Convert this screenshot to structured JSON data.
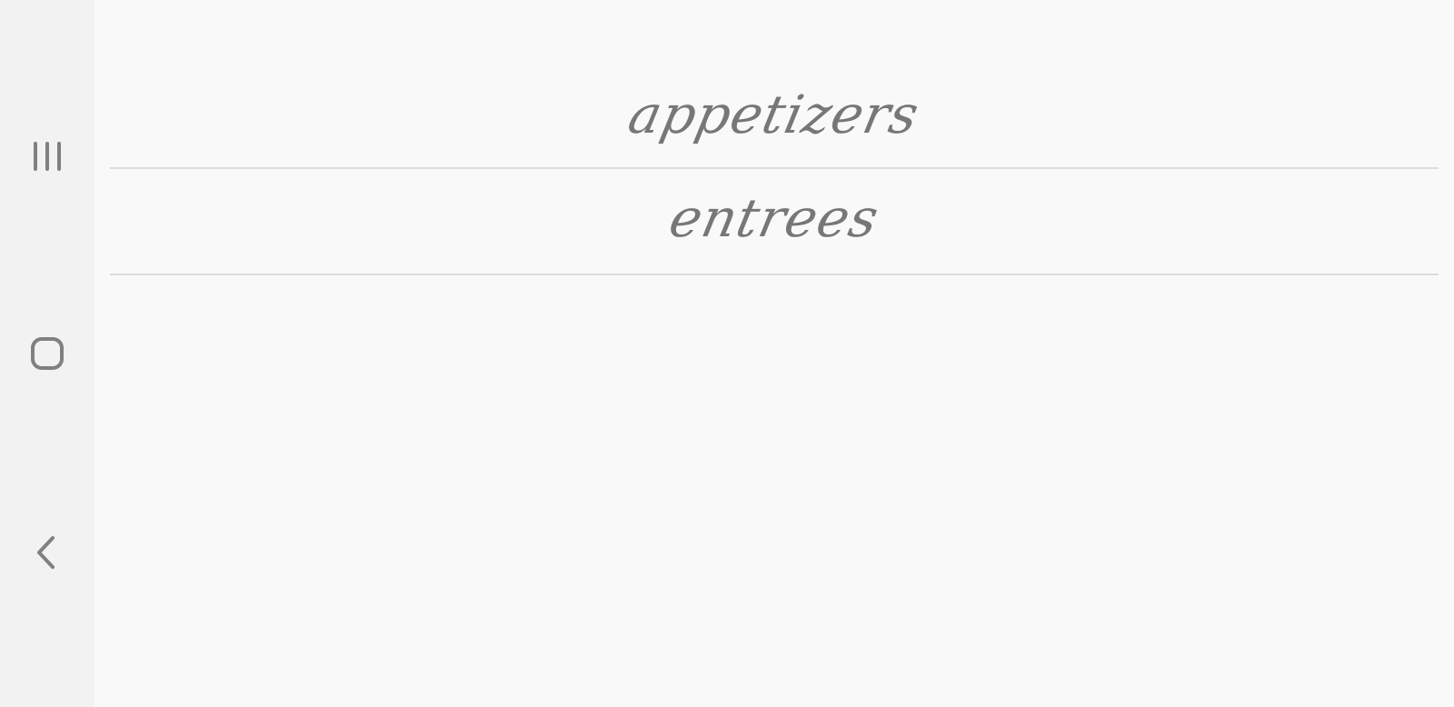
{
  "navigation": {
    "recents_icon": "recent-apps-icon",
    "home_icon": "home-icon",
    "back_icon": "back-icon",
    "icon_color": "#808080"
  },
  "menu": {
    "categories": [
      {
        "label": "appetizers"
      },
      {
        "label": "entrees"
      }
    ]
  },
  "colors": {
    "background": "#f9f9f9",
    "navbar": "#f2f2f2",
    "text": "#777777",
    "divider": "#dcdcdc"
  }
}
